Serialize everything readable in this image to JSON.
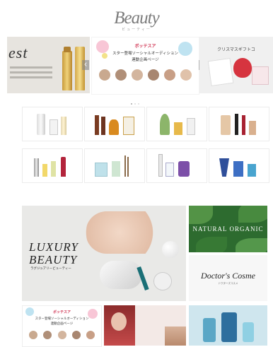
{
  "header": {
    "logo": "Beauty",
    "logo_sub": "ビューティー"
  },
  "carousel": {
    "slides": [
      {
        "brand": "est",
        "lines": [
          "",
          "",
          ""
        ]
      },
      {
        "tag": "",
        "title": "ボッテスア",
        "line1": "スター登場ソーシャルオーディション",
        "line2": "連動企画ページ",
        "footer": ""
      },
      {
        "line1": "",
        "line2": "クリスマスギフトコ"
      }
    ],
    "prev_label": "‹",
    "next_label": "›"
  },
  "section_categories": {
    "title": ""
  },
  "categories": [
    {
      "label": ""
    },
    {
      "label": ""
    },
    {
      "label": ""
    },
    {
      "label": ""
    },
    {
      "label": ""
    },
    {
      "label": ""
    },
    {
      "label": ""
    },
    {
      "label": ""
    }
  ],
  "section_features": {
    "title": ""
  },
  "features": {
    "luxury": {
      "title_line1": "LUXURY",
      "title_line2": "BEAUTY",
      "subtitle": "ラグジュアリービューティー"
    },
    "natural": {
      "title": "NATURAL ORGANIC",
      "subtitle": ""
    },
    "doctor": {
      "title": "Doctor's Cosme",
      "subtitle": "ドクターズコスメ"
    }
  },
  "bottom": {
    "tile1": {
      "title": "ボッテスア",
      "line1": "スター登場ソーシャルオーディション",
      "line2": "連動企画ページ"
    },
    "tile2": {
      "line1": "",
      "line2": ""
    }
  },
  "colors": {
    "accent_green": "#3f7d3a",
    "banner_gray": "#e7e4df",
    "arrow_bg": "#888888"
  }
}
